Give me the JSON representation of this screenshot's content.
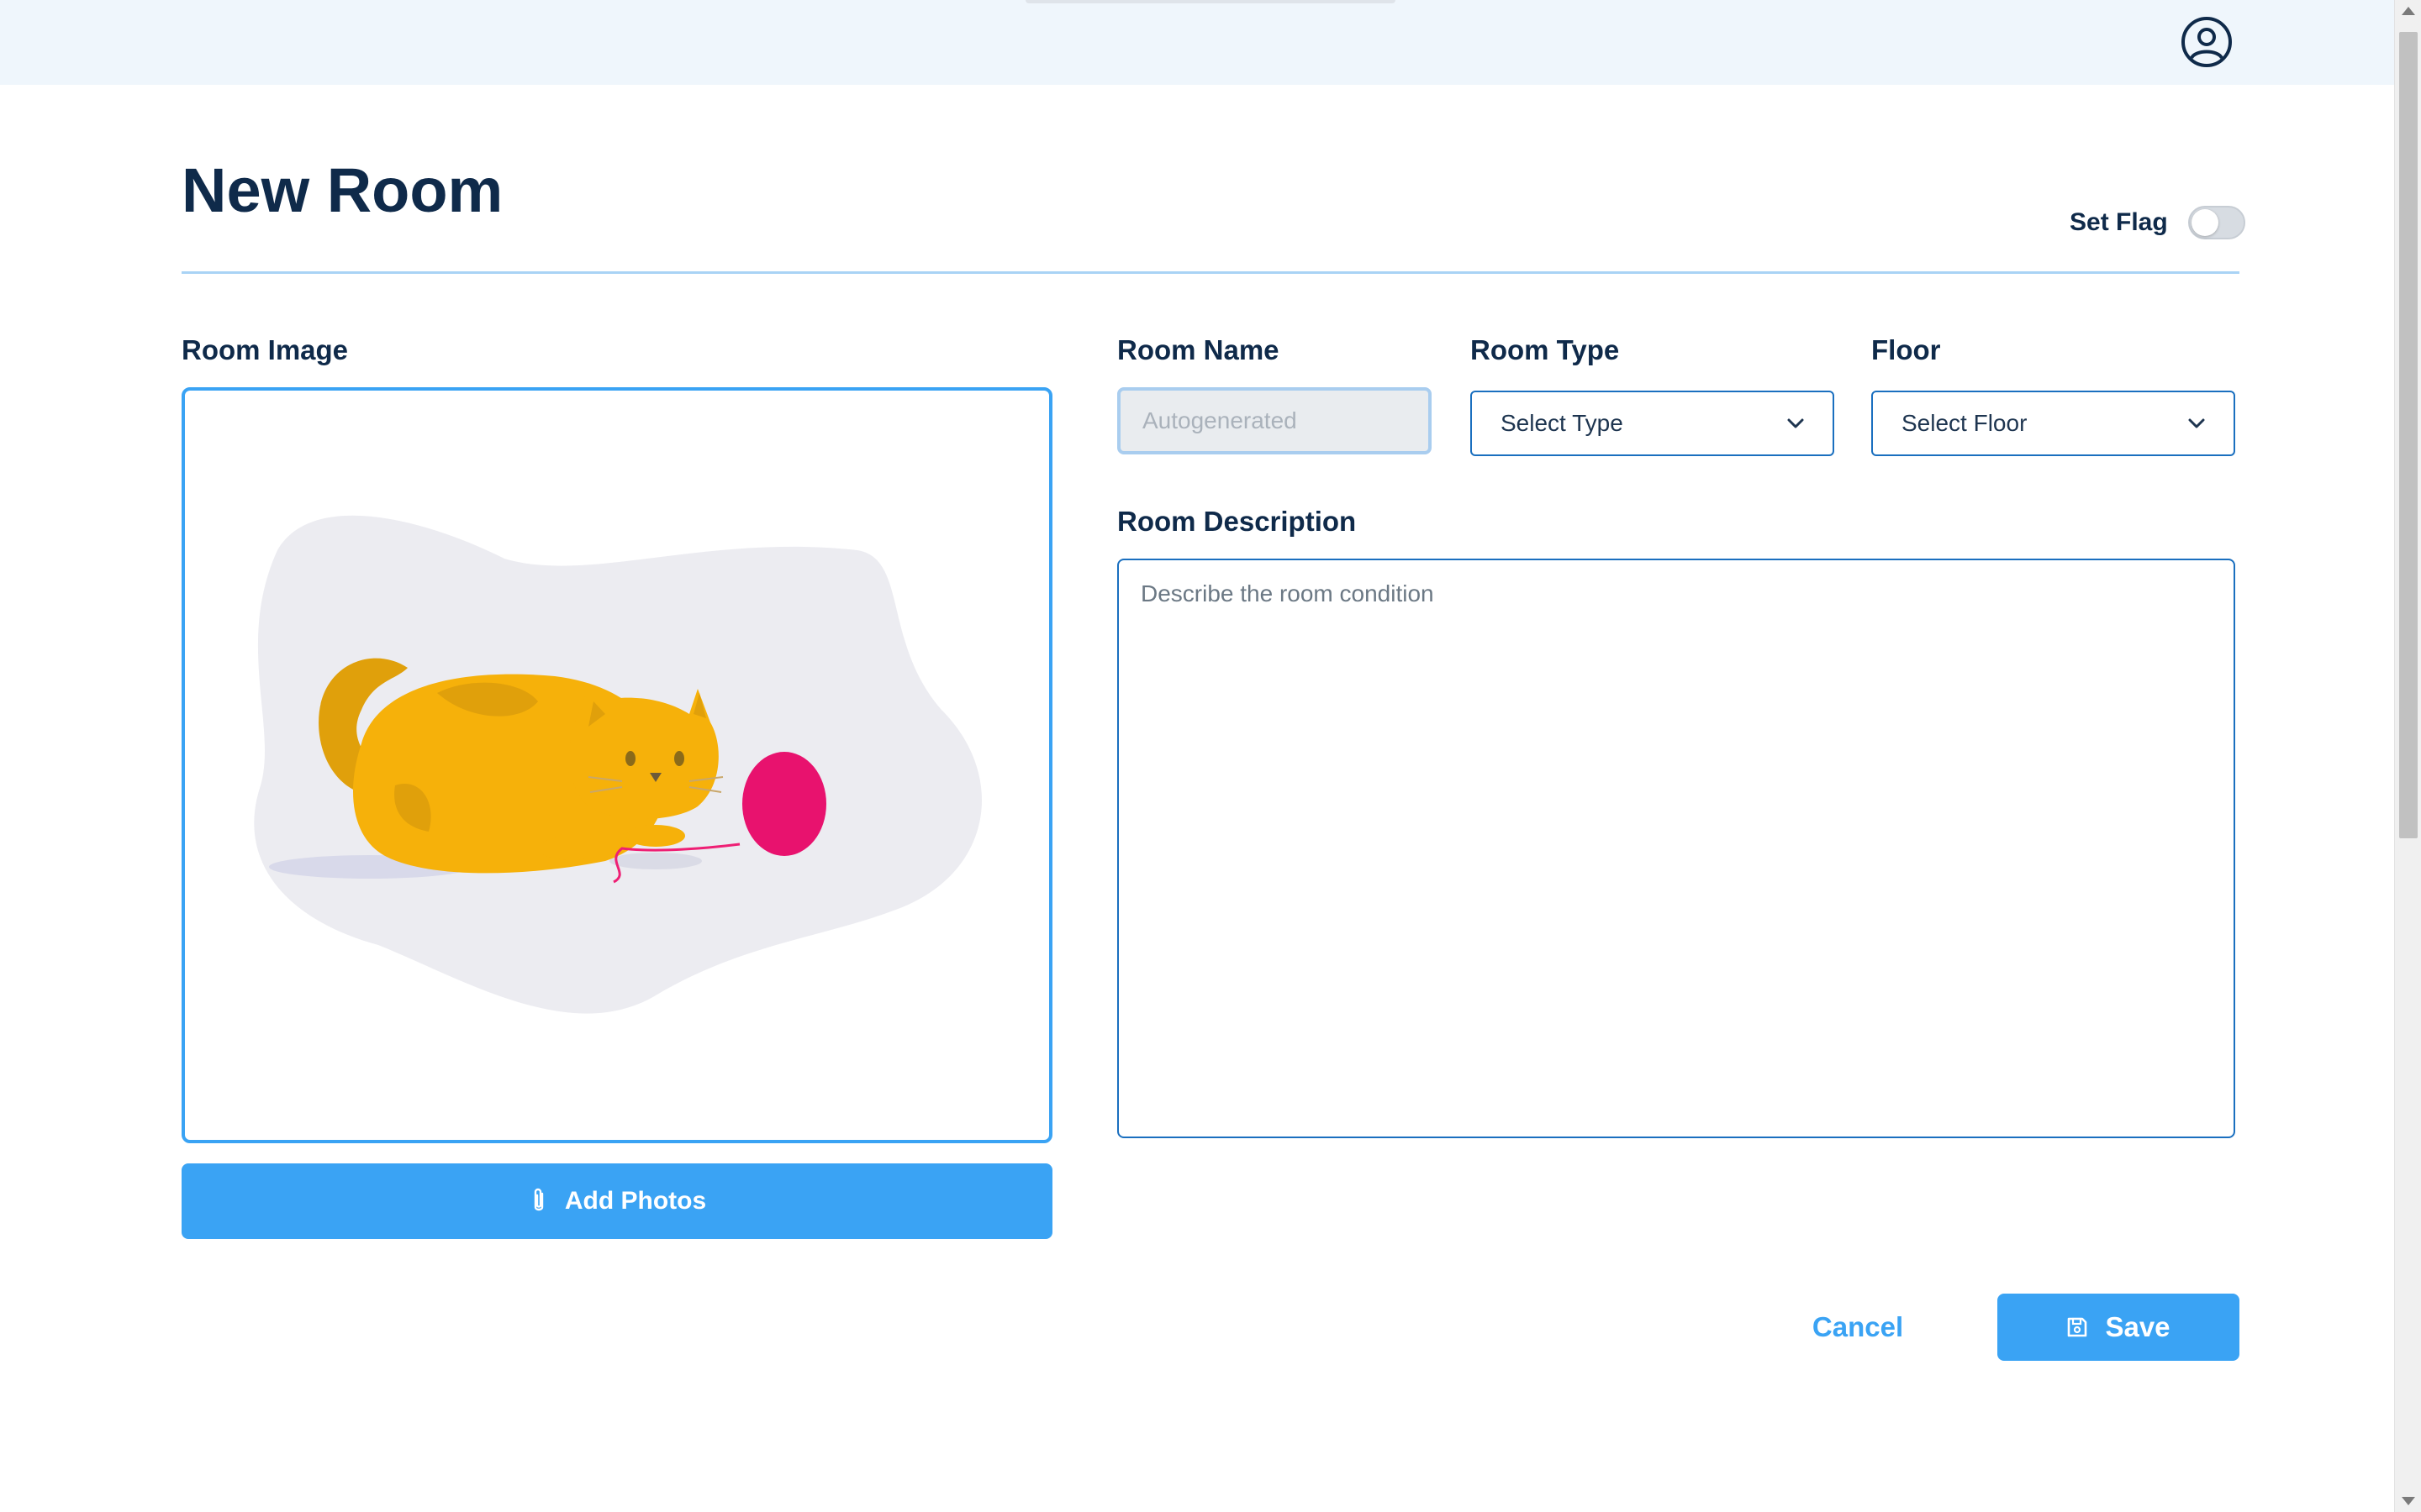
{
  "header": {
    "profile_icon": "user-circle-icon"
  },
  "page": {
    "title": "New Room",
    "flag_label": "Set Flag",
    "flag_enabled": false
  },
  "image_section": {
    "label": "Room Image",
    "placeholder_illustration": "cat-with-yarn-ball",
    "add_photos_label": "Add Photos",
    "add_photos_icon": "paperclip-icon"
  },
  "room_name": {
    "label": "Room Name",
    "placeholder": "Autogenerated",
    "value": ""
  },
  "room_type": {
    "label": "Room Type",
    "selected": "Select Type"
  },
  "floor": {
    "label": "Floor",
    "selected": "Select Floor"
  },
  "description": {
    "label": "Room Description",
    "placeholder": "Describe the room condition",
    "value": ""
  },
  "actions": {
    "cancel_label": "Cancel",
    "save_label": "Save",
    "save_icon": "floppy-disk-icon"
  },
  "colors": {
    "primary": "#3aa3f4",
    "heading": "#0f2a4a",
    "topbar": "#eff6fc",
    "input_border": "#1a6fbf"
  }
}
